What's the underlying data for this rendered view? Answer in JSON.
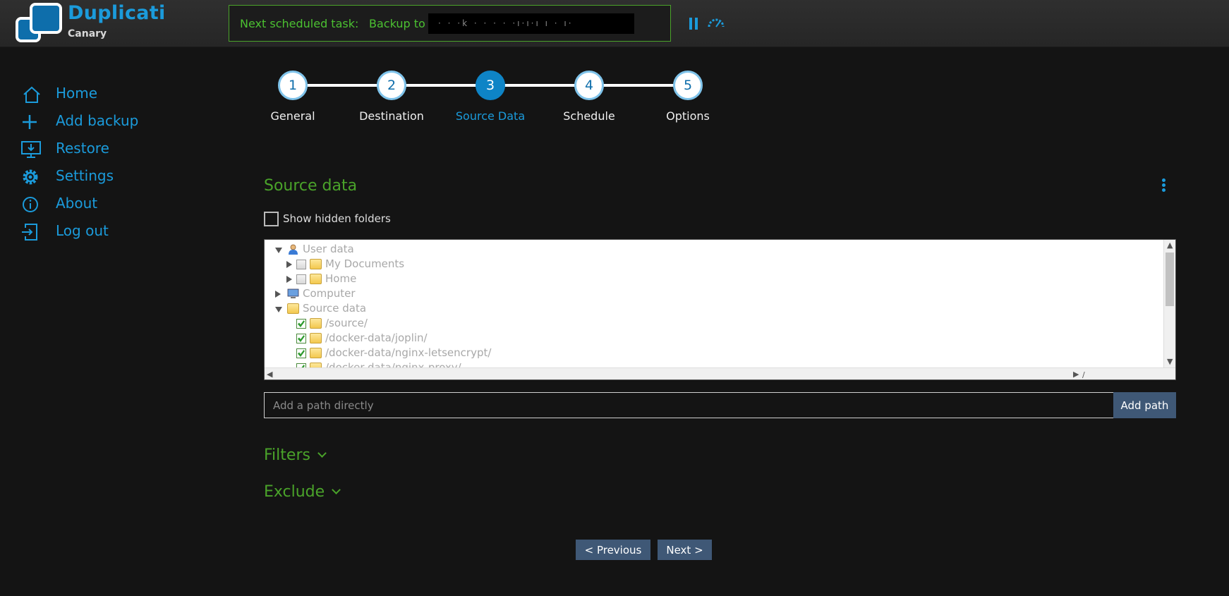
{
  "brand": {
    "name": "Duplicati",
    "edition": "Canary"
  },
  "task": {
    "label": "Next scheduled task:",
    "value": "Backup to",
    "redacted": "·   · ·k   ·  · ·  · ·ı·ı·ı ı  · ı·"
  },
  "nav": [
    {
      "label": "Home",
      "icon": "home-icon"
    },
    {
      "label": "Add backup",
      "icon": "plus-icon"
    },
    {
      "label": "Restore",
      "icon": "restore-icon"
    },
    {
      "label": "Settings",
      "icon": "gear-icon"
    },
    {
      "label": "About",
      "icon": "info-icon"
    },
    {
      "label": "Log out",
      "icon": "logout-icon"
    }
  ],
  "steps": [
    {
      "num": "1",
      "label": "General"
    },
    {
      "num": "2",
      "label": "Destination"
    },
    {
      "num": "3",
      "label": "Source Data",
      "active": true
    },
    {
      "num": "4",
      "label": "Schedule"
    },
    {
      "num": "5",
      "label": "Options"
    }
  ],
  "source": {
    "title": "Source data",
    "show_hidden_label": "Show hidden folders",
    "tree": [
      {
        "label": "User data",
        "level": 0,
        "expand": "down",
        "icon": "user-icon"
      },
      {
        "label": "My Documents",
        "level": 1,
        "expand": "right",
        "checkbox": "off",
        "icon": "folder-user-icon"
      },
      {
        "label": "Home",
        "level": 1,
        "expand": "right",
        "checkbox": "off",
        "icon": "folder-user-icon"
      },
      {
        "label": "Computer",
        "level": 0,
        "expand": "right",
        "icon": "computer-icon"
      },
      {
        "label": "Source data",
        "level": 0,
        "expand": "down",
        "icon": "folder-icon"
      },
      {
        "label": "/source/",
        "level": 1,
        "checkbox": "on",
        "icon": "folder-icon"
      },
      {
        "label": "/docker-data/joplin/",
        "level": 1,
        "checkbox": "on",
        "icon": "folder-icon"
      },
      {
        "label": "/docker-data/nginx-letsencrypt/",
        "level": 1,
        "checkbox": "on",
        "icon": "folder-icon"
      },
      {
        "label": "/docker-data/nginx-proxy/",
        "level": 1,
        "checkbox": "on",
        "icon": "folder-icon"
      }
    ],
    "path_placeholder": "Add a path directly",
    "add_path_label": "Add path"
  },
  "filters_label": "Filters",
  "exclude_label": "Exclude",
  "buttons": {
    "previous": "< Previous",
    "next": "Next >"
  },
  "colors": {
    "accent": "#1b9bdb",
    "green": "#4aa32a",
    "button": "#3f5876",
    "background": "#141414"
  }
}
